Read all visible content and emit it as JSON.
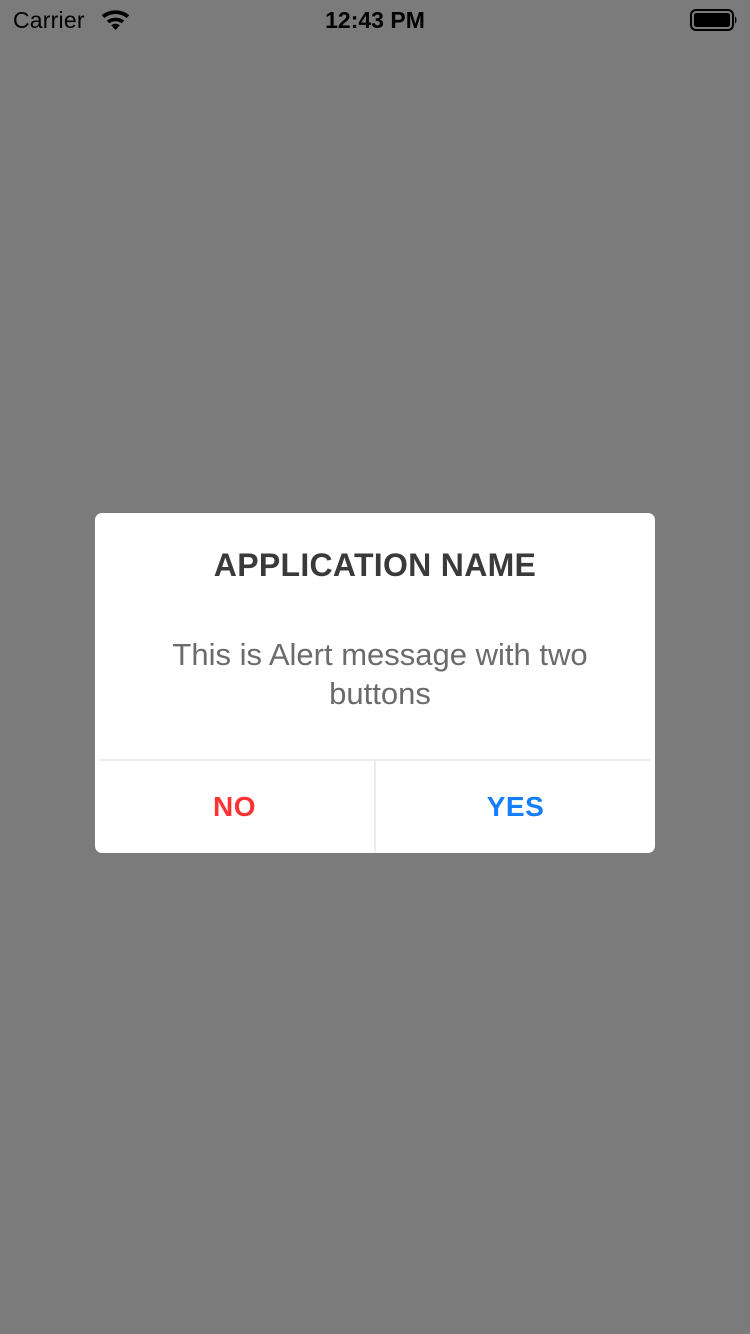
{
  "status_bar": {
    "carrier": "Carrier",
    "time": "12:43 PM",
    "icons": [
      "wifi-icon",
      "battery-icon"
    ]
  },
  "alert": {
    "title": "APPLICATION NAME",
    "message": "This is Alert message with two buttons",
    "buttons": {
      "no_label": "NO",
      "yes_label": "YES"
    }
  },
  "colors": {
    "overlay": "#7b7b7b",
    "alert_bg": "#ffffff",
    "title": "#3a3a3a",
    "message": "#6b6b6b",
    "no_button": "#ff3333",
    "yes_button": "#147efb"
  }
}
